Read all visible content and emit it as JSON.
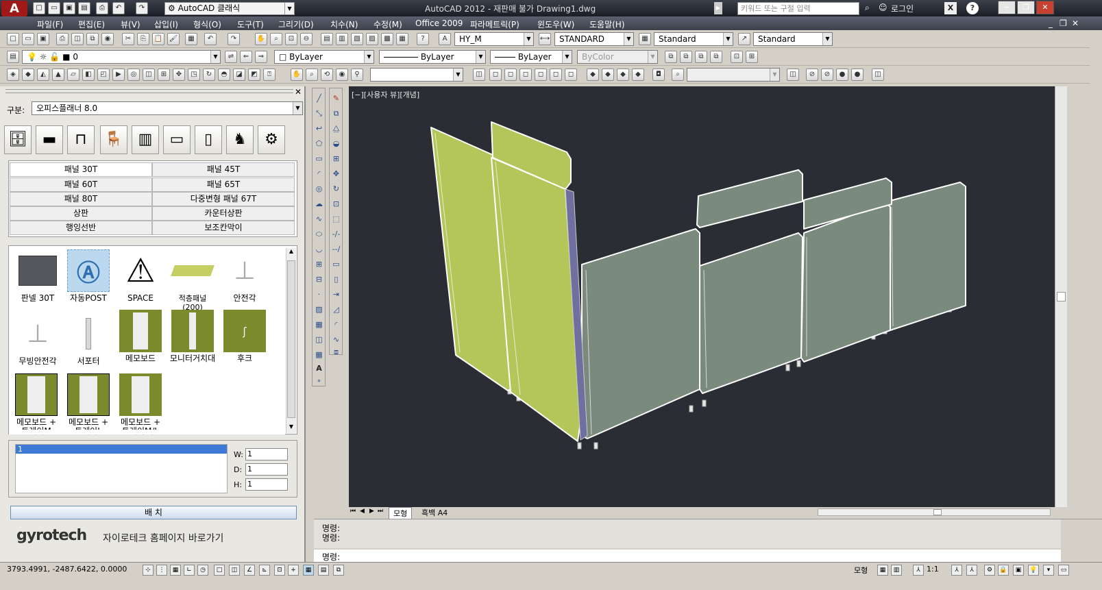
{
  "title_bar": {
    "app_logo": "A",
    "workspace": "AutoCAD 클래식",
    "title": "AutoCAD 2012 - 재판매 불가    Drawing1.dwg",
    "search_placeholder": "키워드 또는 구절 입력",
    "login": "로그인"
  },
  "menu": [
    "파일(F)",
    "편집(E)",
    "뷰(V)",
    "삽입(I)",
    "형식(O)",
    "도구(T)",
    "그리기(D)",
    "치수(N)",
    "수정(M)",
    "Office 2009",
    "파라메트릭(P)",
    "윈도우(W)",
    "도움말(H)"
  ],
  "toolbar": {
    "text_style": "HY_M",
    "dim_style": "STANDARD",
    "table_style": "Standard",
    "mleader_style": "Standard",
    "layer": "0",
    "color": "ByLayer",
    "linetype": "ByLayer",
    "lineweight": "ByLayer",
    "plotstyle": "ByColor"
  },
  "palette": {
    "category_label": "구분:",
    "category_value": "오피스플래너 8.0",
    "category_icons": [
      "desk-icon",
      "executive-desk-icon",
      "l-desk-icon",
      "student-chair-icon",
      "workstation-icon",
      "cabinet-icon",
      "locker-icon",
      "office-chair-icon",
      "gear-icon"
    ],
    "panel_types": [
      [
        "패널 30T",
        "패널 45T"
      ],
      [
        "패널 60T",
        "패널 65T"
      ],
      [
        "패널 80T",
        "다중변형 패널 67T"
      ],
      [
        "상판",
        "카운터상판"
      ],
      [
        "행잉선반",
        "보조칸막이"
      ]
    ],
    "parts": [
      {
        "label": "판넬 30T",
        "icon": "panel-box-icon"
      },
      {
        "label": "자동POST",
        "icon": "auto-post-icon"
      },
      {
        "label": "SPACE",
        "icon": "warning-icon"
      },
      {
        "label": "적층패널\n(200)",
        "icon": "stack-panel-icon"
      },
      {
        "label": "안전각",
        "icon": "safety-leg-icon"
      },
      {
        "label": "무빙안전각",
        "icon": "caster-leg-icon"
      },
      {
        "label": "서포터",
        "icon": "supporter-icon"
      },
      {
        "label": "메모보드",
        "icon": "memo-board-icon"
      },
      {
        "label": "모니터거치대",
        "icon": "monitor-stand-icon"
      },
      {
        "label": "후크",
        "icon": "hook-icon"
      },
      {
        "label": "메모보드 +\n트레이M",
        "icon": "memo-tray-icon"
      },
      {
        "label": "메모보드 +\n트레이L",
        "icon": "memo-tray-icon"
      },
      {
        "label": "메모보드 +\n트레이M/L",
        "icon": "memo-tray-icon"
      }
    ],
    "list_value": "1",
    "w_label": "W:",
    "w_value": "1",
    "d_label": "D:",
    "d_value": "1",
    "h_label": "H:",
    "h_value": "1",
    "place_button": "배 치",
    "brand": "gyrotech",
    "brand_link": "자이로테크 홈페이지 바로가기"
  },
  "viewport": {
    "label": "[−][사용자 뷰][개념]",
    "panel_color": "#b4c55a",
    "panel_gray": "#7a8a7c",
    "background": "#2a2d33"
  },
  "layout_tabs": [
    "모형",
    "흑백 A4"
  ],
  "command": {
    "history": [
      "명령:",
      "명령:"
    ],
    "prompt": "명령:"
  },
  "status": {
    "coords": "3793.4991, -2487.6422, 0.0000",
    "model": "모형",
    "scale": "1:1"
  }
}
